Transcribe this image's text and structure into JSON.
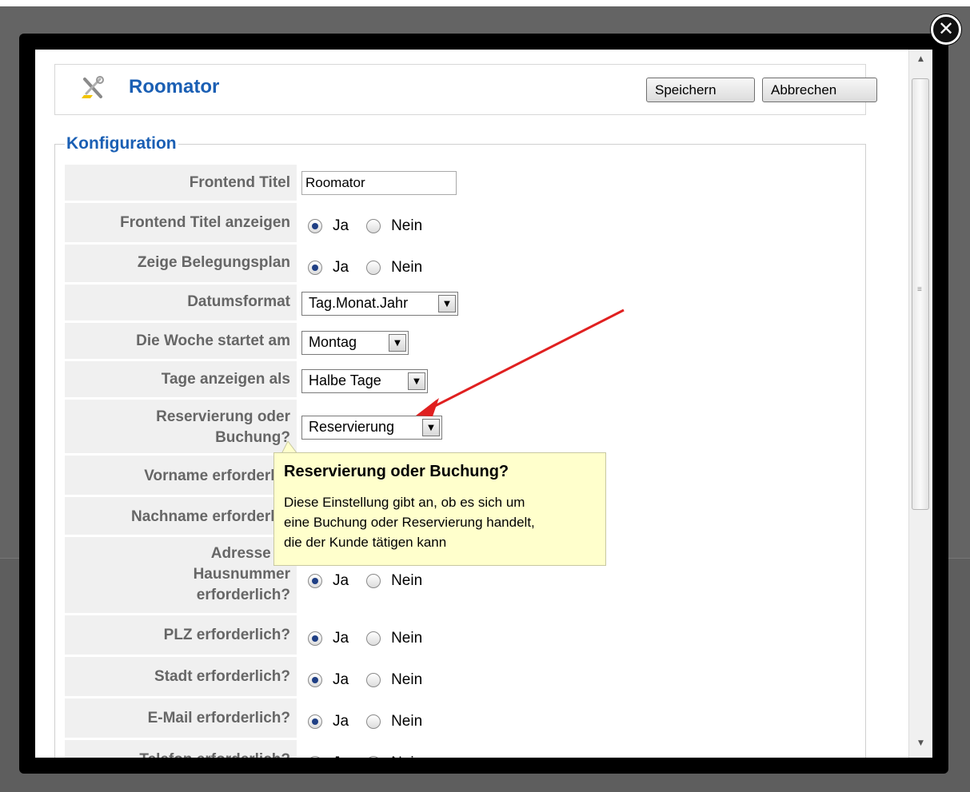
{
  "app": {
    "title": "Roomator"
  },
  "toolbar": {
    "save_label": "Speichern",
    "cancel_label": "Abbrechen"
  },
  "section": {
    "legend": "Konfiguration"
  },
  "form": {
    "frontend_title_label": "Frontend Titel",
    "frontend_title_value": "Roomator",
    "show_title_label": "Frontend Titel anzeigen",
    "show_plan_label": "Zeige Belegungsplan",
    "date_format_label": "Datumsformat",
    "date_format_value": "Tag.Monat.Jahr",
    "week_start_label": "Die Woche startet am",
    "week_start_value": "Montag",
    "days_display_label": "Tage anzeigen als",
    "days_display_value": "Halbe Tage",
    "reservation_label_line1": "Reservierung oder",
    "reservation_label_line2": "Buchung?",
    "reservation_value": "Reservierung",
    "firstname_label": "Vorname erforderlich",
    "lastname_label": "Nachname erforderlich",
    "address_label_line1": "Adresse ur",
    "address_label_line2": "Hausnummer",
    "address_label_line3": "erforderlich?",
    "zip_label": "PLZ erforderlich?",
    "city_label": "Stadt erforderlich?",
    "email_label": "E-Mail erforderlich?",
    "phone_label": "Telefon erforderlich?",
    "yes": "Ja",
    "no": "Nein"
  },
  "tooltip": {
    "title": "Reservierung oder Buchung?",
    "line1": "Diese Einstellung gibt an, ob es sich um",
    "line2": "eine Buchung oder Reservierung handelt,",
    "line3": "die der Kunde tätigen kann"
  },
  "icons": {
    "close": "close-icon",
    "tools": "tools-icon",
    "select_arrow": "chevron-down-icon",
    "scroll_up": "scroll-up-arrow",
    "scroll_down": "scroll-down-arrow"
  },
  "colors": {
    "accent_blue": "#1a5fb4",
    "tooltip_bg": "#ffffcc",
    "annotation_red": "#e02020",
    "label_bg": "#f0f0f0"
  }
}
